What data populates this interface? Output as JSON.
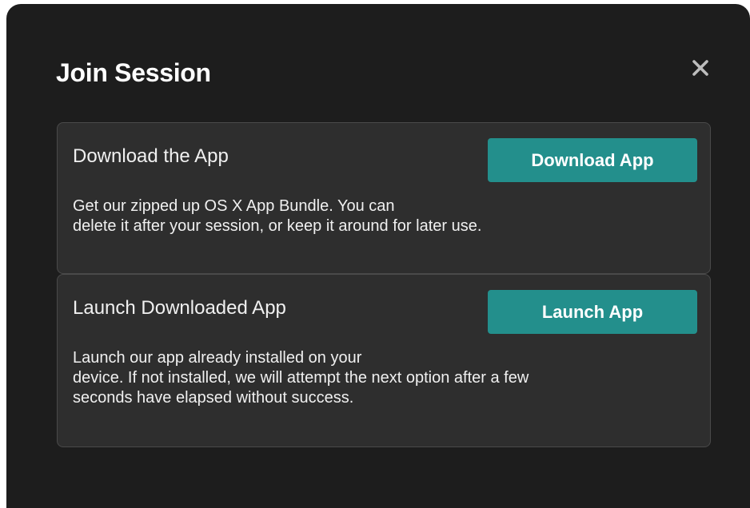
{
  "modal": {
    "title": "Join Session",
    "close_icon": "close-icon"
  },
  "options": {
    "download": {
      "title": "Download the App",
      "button_label": "Download App",
      "description_lines": [
        "Get our zipped up OS X App Bundle. You can",
        "delete it after your session, or keep it around for later use."
      ]
    },
    "launch": {
      "title": "Launch Downloaded App",
      "button_label": "Launch App",
      "description_lines": [
        "Launch our app already installed on your",
        "device. If not installed, we will attempt the next option after a few",
        "seconds have elapsed without success."
      ]
    }
  },
  "colors": {
    "modal_background": "#1d1d1d",
    "card_background": "#2e2e2e",
    "card_border": "#4a4a4a",
    "accent_button": "#238f8c",
    "text": "#f0f0f0"
  }
}
